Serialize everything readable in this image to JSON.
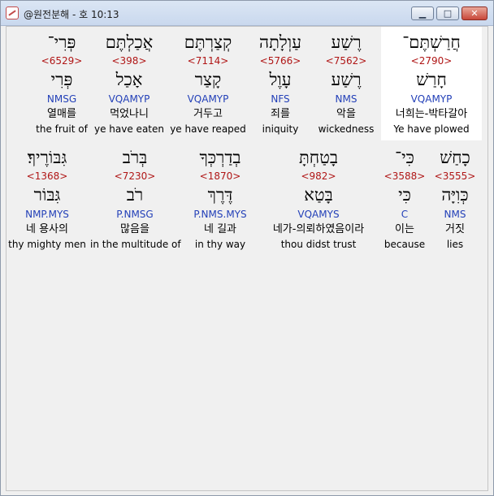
{
  "window": {
    "title": "@원전분해 - 호 10:13",
    "minimize_glyph": "▁",
    "maximize_glyph": "□",
    "close_glyph": "✕"
  },
  "rows": [
    {
      "words": [
        {
          "hebrew": "פְּרִי־",
          "strong": "<6529>",
          "lemma": "פְּרִי",
          "parse": "NMSG",
          "korean": "열매를",
          "english": "the fruit of"
        },
        {
          "hebrew": "אֲכַלְתֶּם",
          "strong": "<398>",
          "lemma": "אָכַל",
          "parse": "VQAMYP",
          "korean": "먹었나니",
          "english": "ye have eaten"
        },
        {
          "hebrew": "קְצַרְתֶּם",
          "strong": "<7114>",
          "lemma": "קָצַר",
          "parse": "VQAMYP",
          "korean": "거두고",
          "english": "ye have reaped"
        },
        {
          "hebrew": "עַוְלָתָה",
          "strong": "<5766>",
          "lemma": "עָוֶל",
          "parse": "NFS",
          "korean": "죄를",
          "english": "iniquity"
        },
        {
          "hebrew": "רֶשַׁע",
          "strong": "<7562>",
          "lemma": "רֶשַׁע",
          "parse": "NMS",
          "korean": "악을",
          "english": "wickedness"
        },
        {
          "hebrew": "חֲרַשְׁתֶּם־",
          "strong": "<2790>",
          "lemma": "חָרַשׁ",
          "parse": "VQAMYP",
          "korean": "너희는-박타갈아",
          "english": "Ye have plowed"
        }
      ]
    },
    {
      "words": [
        {
          "hebrew": "גִּבּוֹרֶיךָ׃",
          "strong": "<1368>",
          "lemma": "גִּבּוֹר",
          "parse": "NMP.MYS",
          "korean": "네 용사의",
          "english": "thy mighty men"
        },
        {
          "hebrew": "בְּרֹב",
          "strong": "<7230>",
          "lemma": "רֹב",
          "parse": "P.NMSG",
          "korean": "많음을",
          "english": "in the multitude of"
        },
        {
          "hebrew": "בְדַרְכְּךָ",
          "strong": "<1870>",
          "lemma": "דֶּרֶךְ",
          "parse": "P.NMS.MYS",
          "korean": "네 길과",
          "english": "in thy way"
        },
        {
          "hebrew": "בָטַחְתָּ",
          "strong": "<982>",
          "lemma": "בָּטַא",
          "parse": "VQAMYS",
          "korean": "네가-의뢰하였음이라",
          "english": "thou didst trust"
        },
        {
          "hebrew": "כִּי־",
          "strong": "<3588>",
          "lemma": "כִּי",
          "parse": "C",
          "korean": "이는",
          "english": "because"
        },
        {
          "hebrew": "כָחַשׁ",
          "strong": "<3555>",
          "lemma": "כְּוִיָּה",
          "parse": "NMS",
          "korean": "거짓",
          "english": "lies"
        }
      ]
    }
  ]
}
